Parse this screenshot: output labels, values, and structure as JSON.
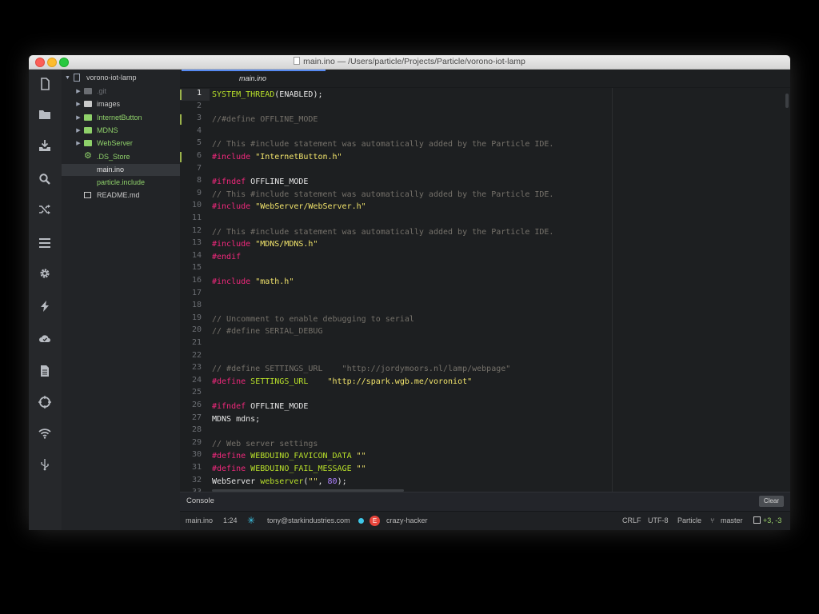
{
  "window": {
    "title": "main.ino — /Users/particle/Projects/Particle/vorono-iot-lamp"
  },
  "sidebar_icons": [
    "file-icon",
    "folder-icon",
    "download-icon",
    "search-icon",
    "shuffle-icon",
    "list-icon",
    "gear-icon",
    "flash-icon",
    "cloud-icon",
    "document-icon",
    "target-icon",
    "wifi-icon",
    "usb-icon"
  ],
  "tree": {
    "root": "vorono-iot-lamp",
    "items": [
      {
        "label": ".git",
        "kind": "folder",
        "color": "#6b6e73"
      },
      {
        "label": "images",
        "kind": "folder",
        "color": "#c9c9c9"
      },
      {
        "label": "InternetButton",
        "kind": "folder",
        "color": "#8fd16a"
      },
      {
        "label": "MDNS",
        "kind": "folder",
        "color": "#8fd16a"
      },
      {
        "label": "WebServer",
        "kind": "folder",
        "color": "#8fd16a"
      },
      {
        "label": ".DS_Store",
        "kind": "gear",
        "color": "#8fd16a"
      },
      {
        "label": "main.ino",
        "kind": "file",
        "color": "#e6e6e6"
      },
      {
        "label": "particle.include",
        "kind": "file",
        "color": "#8fd16a"
      },
      {
        "label": "README.md",
        "kind": "book",
        "color": "#c9c9c9"
      }
    ]
  },
  "editor": {
    "tab": "main.ino",
    "lines": [
      {
        "n": "1",
        "tokens": [
          [
            "SYSTEM_THREAD",
            "mac"
          ],
          [
            "(ENABLED);",
            ""
          ]
        ]
      },
      {
        "n": "2",
        "tokens": []
      },
      {
        "n": "3",
        "tokens": [
          [
            "//#define OFFLINE_MODE",
            "cm"
          ]
        ]
      },
      {
        "n": "4",
        "tokens": []
      },
      {
        "n": "5",
        "tokens": [
          [
            "// This #include statement was automatically added by the Particle IDE.",
            "cm"
          ]
        ]
      },
      {
        "n": "6",
        "tokens": [
          [
            "#include ",
            "kw"
          ],
          [
            "\"InternetButton.h\"",
            "str"
          ]
        ]
      },
      {
        "n": "7",
        "tokens": []
      },
      {
        "n": "8",
        "tokens": [
          [
            "#ifndef ",
            "kw"
          ],
          [
            "OFFLINE_MODE",
            ""
          ]
        ]
      },
      {
        "n": "9",
        "tokens": [
          [
            "// This #include statement was automatically added by the Particle IDE.",
            "cm"
          ]
        ]
      },
      {
        "n": "10",
        "tokens": [
          [
            "#include ",
            "kw"
          ],
          [
            "\"WebServer/WebServer.h\"",
            "str"
          ]
        ]
      },
      {
        "n": "11",
        "tokens": []
      },
      {
        "n": "12",
        "tokens": [
          [
            "// This #include statement was automatically added by the Particle IDE.",
            "cm"
          ]
        ]
      },
      {
        "n": "13",
        "tokens": [
          [
            "#include ",
            "kw"
          ],
          [
            "\"MDNS/MDNS.h\"",
            "str"
          ]
        ]
      },
      {
        "n": "14",
        "tokens": [
          [
            "#endif",
            "kw"
          ]
        ]
      },
      {
        "n": "15",
        "tokens": []
      },
      {
        "n": "16",
        "tokens": [
          [
            "#include ",
            "kw"
          ],
          [
            "\"math.h\"",
            "str"
          ]
        ]
      },
      {
        "n": "17",
        "tokens": []
      },
      {
        "n": "18",
        "tokens": []
      },
      {
        "n": "19",
        "tokens": [
          [
            "// Uncomment to enable debugging to serial",
            "cm"
          ]
        ]
      },
      {
        "n": "20",
        "tokens": [
          [
            "// #define SERIAL_DEBUG",
            "cm"
          ]
        ]
      },
      {
        "n": "21",
        "tokens": []
      },
      {
        "n": "22",
        "tokens": []
      },
      {
        "n": "23",
        "tokens": [
          [
            "// #define SETTINGS_URL    \"http://jordymoors.nl/lamp/webpage\"",
            "cm"
          ]
        ]
      },
      {
        "n": "24",
        "tokens": [
          [
            "#define ",
            "kw"
          ],
          [
            "SETTINGS_URL",
            "mac"
          ],
          [
            "    ",
            ""
          ],
          [
            "\"http://spark.wgb.me/voroniot\"",
            "str"
          ]
        ]
      },
      {
        "n": "25",
        "tokens": []
      },
      {
        "n": "26",
        "tokens": [
          [
            "#ifndef ",
            "kw"
          ],
          [
            "OFFLINE_MODE",
            ""
          ]
        ]
      },
      {
        "n": "27",
        "tokens": [
          [
            "MDNS mdns;",
            ""
          ]
        ]
      },
      {
        "n": "28",
        "tokens": []
      },
      {
        "n": "29",
        "tokens": [
          [
            "// Web server settings",
            "cm"
          ]
        ]
      },
      {
        "n": "30",
        "tokens": [
          [
            "#define ",
            "kw"
          ],
          [
            "WEBDUINO_FAVICON_DATA",
            "mac"
          ],
          [
            " ",
            ""
          ],
          [
            "\"\"",
            "str"
          ]
        ]
      },
      {
        "n": "31",
        "tokens": [
          [
            "#define ",
            "kw"
          ],
          [
            "WEBDUINO_FAIL_MESSAGE",
            "mac"
          ],
          [
            " ",
            ""
          ],
          [
            "\"\"",
            "str"
          ]
        ]
      },
      {
        "n": "32",
        "tokens": [
          [
            "WebServer ",
            ""
          ],
          [
            "webserver",
            "fn"
          ],
          [
            "(",
            ""
          ],
          [
            "\"\"",
            "str"
          ],
          [
            ", ",
            ""
          ],
          [
            "80",
            "num"
          ],
          [
            ");",
            ""
          ]
        ]
      },
      {
        "n": "33",
        "tokens": []
      }
    ]
  },
  "console": {
    "label": "Console",
    "clear_label": "Clear"
  },
  "status": {
    "file": "main.ino",
    "position": "1:24",
    "user": "tony@starkindustries.com",
    "device_badge": "E",
    "device": "crazy-hacker",
    "line_ending": "CRLF",
    "encoding": "UTF-8",
    "grammar": "Particle",
    "branch": "master",
    "diff": "+3, -3"
  },
  "colors": {
    "accent": "#568af2",
    "keyword": "#f0287c",
    "string": "#f1e36b",
    "comment": "#75716a",
    "macro": "#b9e12a",
    "number": "#ae81ff",
    "device_badge": "#e8453c",
    "status_dot": "#3ec7e8"
  }
}
